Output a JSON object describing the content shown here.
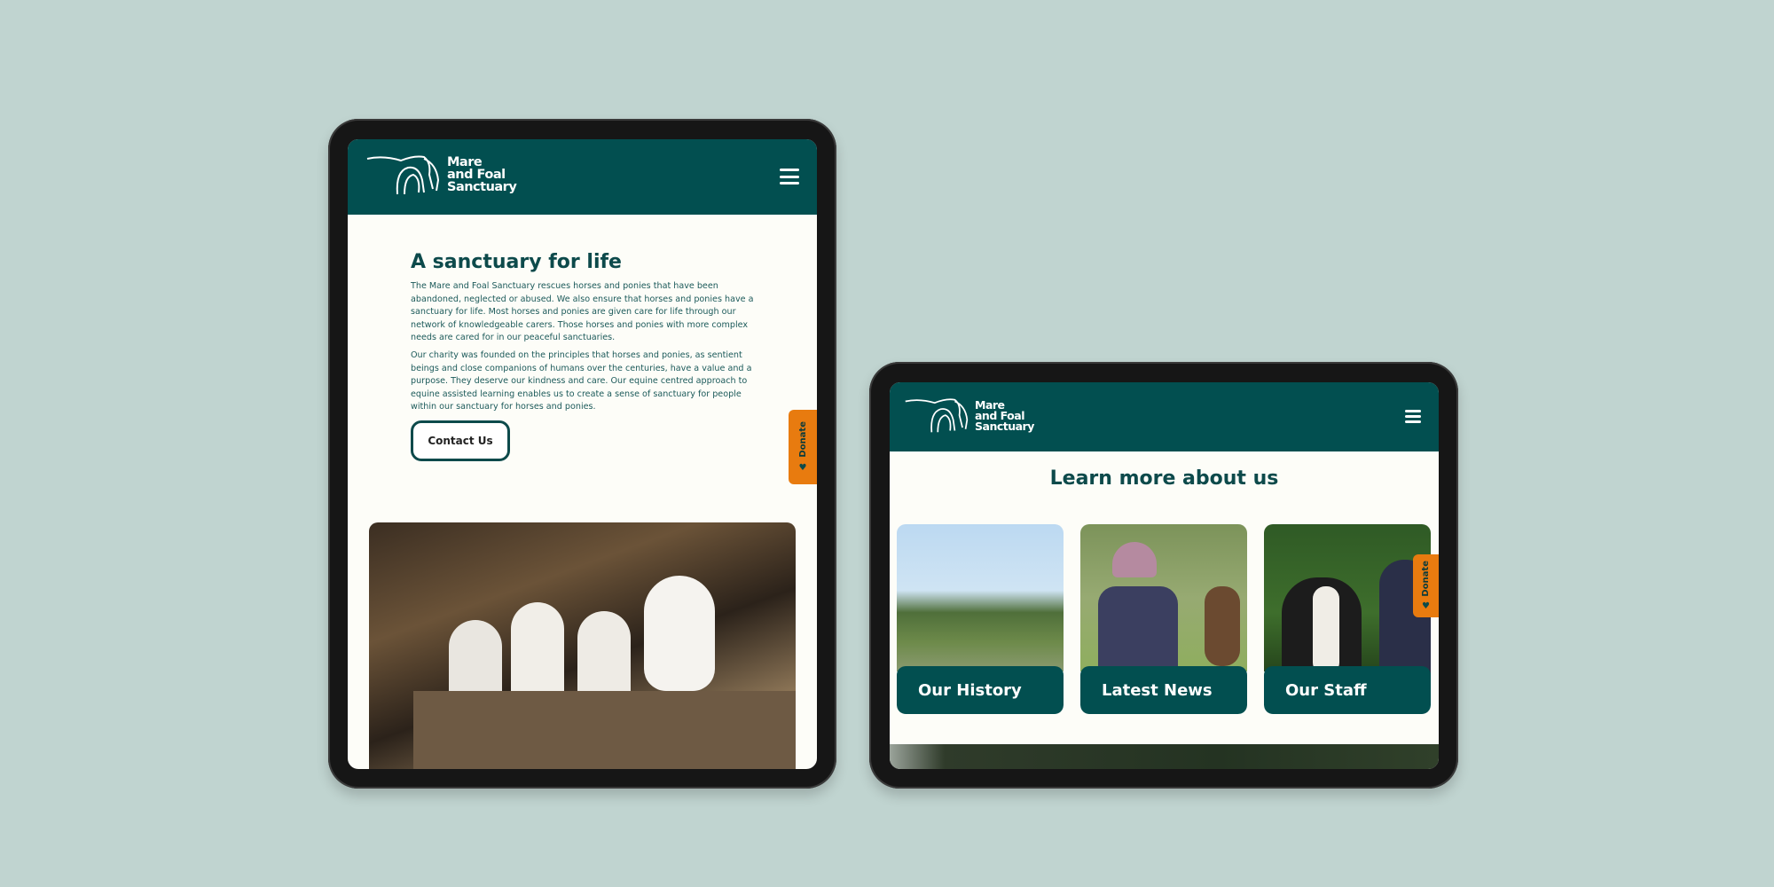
{
  "brand": {
    "name_lines": [
      "Mare",
      "and Foal",
      "Sanctuary"
    ],
    "colors": {
      "primary": "#024f50",
      "accent": "#e87b0f",
      "background": "#c0d4d0",
      "page": "#fdfdf8"
    }
  },
  "left_tablet": {
    "menu_icon": "hamburger-icon",
    "donate_label": "Donate",
    "heading": "A sanctuary for life",
    "paragraphs": [
      "The Mare and Foal Sanctuary rescues horses and ponies that have been abandoned, neglected or abused.  We also ensure that horses and ponies have a sanctuary for life. Most horses and ponies are given care for life through our network of knowledgeable carers. Those horses and ponies with more complex needs are cared for in our peaceful sanctuaries.",
      "Our charity was founded on the principles that horses and ponies, as sentient beings and close companions of humans over the centuries, have a value and a purpose. They deserve our kindness and care. Our equine centred approach to equine assisted learning enables us to create a sense of sanctuary for people within our sanctuary for horses and ponies."
    ],
    "contact_button": "Contact Us"
  },
  "right_tablet": {
    "menu_icon": "hamburger-icon",
    "donate_label": "Donate",
    "heading": "Learn more about us",
    "cards": [
      {
        "label": "Our History"
      },
      {
        "label": "Latest News"
      },
      {
        "label": "Our Staff"
      }
    ]
  }
}
